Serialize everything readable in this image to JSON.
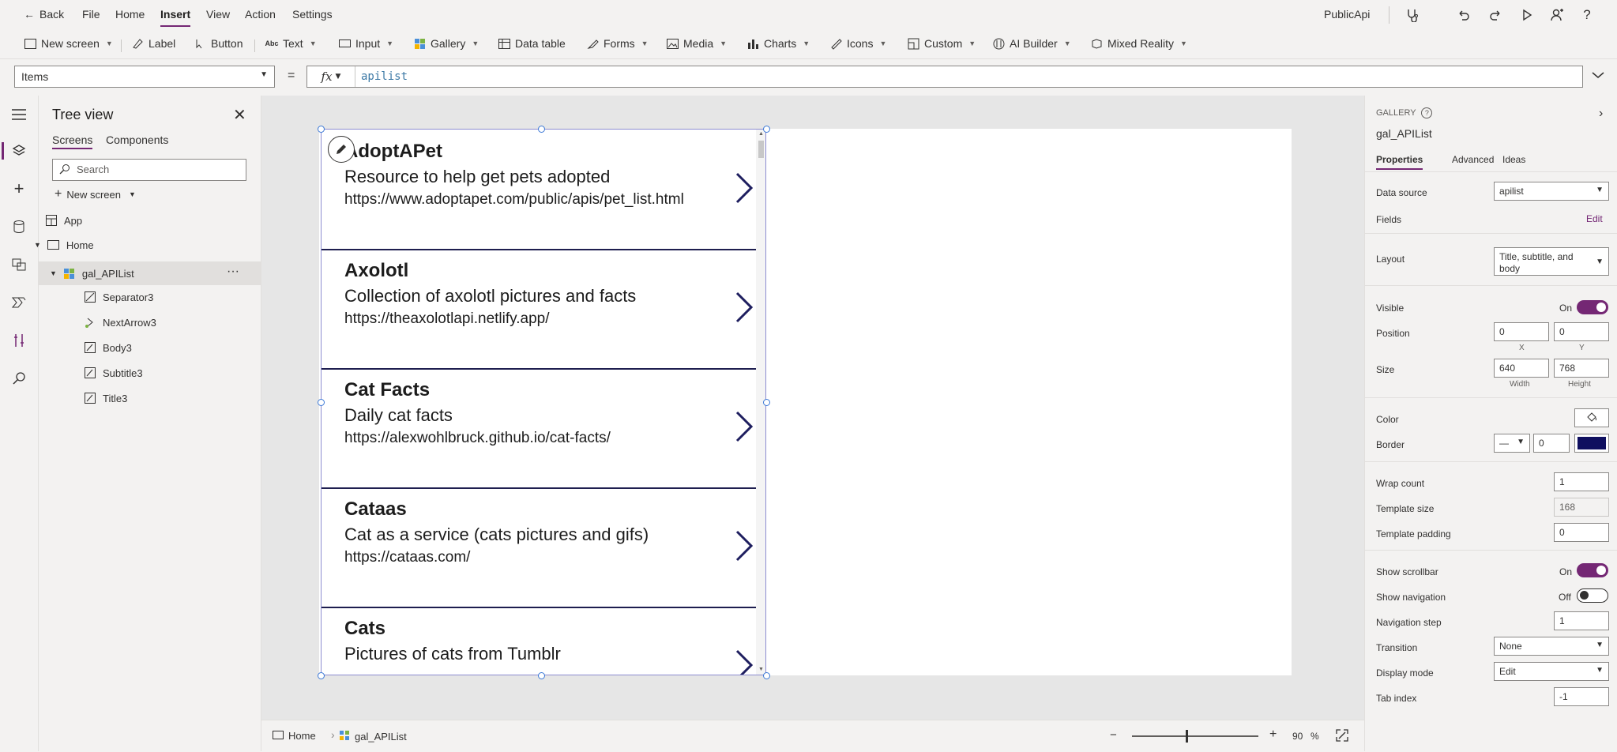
{
  "topbar": {
    "back": "Back",
    "menus": [
      "File",
      "Home",
      "Insert",
      "View",
      "Action",
      "Settings"
    ],
    "active_menu": "Insert",
    "app_name": "PublicApi"
  },
  "ribbon": {
    "items": [
      "New screen",
      "Label",
      "Button",
      "Text",
      "Input",
      "Gallery",
      "Data table",
      "Forms",
      "Media",
      "Charts",
      "Icons",
      "Custom",
      "AI Builder",
      "Mixed Reality"
    ]
  },
  "formula": {
    "property": "Items",
    "equals": "=",
    "fx": "fx",
    "value": "apilist"
  },
  "tree": {
    "title": "Tree view",
    "tabs": [
      "Screens",
      "Components"
    ],
    "search_placeholder": "Search",
    "new_screen": "New screen",
    "items": {
      "app": "App",
      "home": "Home",
      "gallery": "gal_APIList",
      "separator": "Separator3",
      "arrow": "NextArrow3",
      "body": "Body3",
      "subtitle": "Subtitle3",
      "title": "Title3"
    }
  },
  "gallery": {
    "rows": [
      {
        "title": "AdoptAPet",
        "subtitle": "Resource to help get pets adopted",
        "body": "https://www.adoptapet.com/public/apis/pet_list.html"
      },
      {
        "title": "Axolotl",
        "subtitle": "Collection of axolotl pictures and facts",
        "body": "https://theaxolotlapi.netlify.app/"
      },
      {
        "title": "Cat Facts",
        "subtitle": "Daily cat facts",
        "body": "https://alexwohlbruck.github.io/cat-facts/"
      },
      {
        "title": "Cataas",
        "subtitle": "Cat as a service (cats pictures and gifs)",
        "body": "https://cataas.com/"
      },
      {
        "title": "Cats",
        "subtitle": "Pictures of cats from Tumblr",
        "body": ""
      }
    ]
  },
  "status": {
    "screen": "Home",
    "control": "gal_APIList",
    "zoom": "90",
    "zoom_unit": "%",
    "minus": "−",
    "plus": "+"
  },
  "props": {
    "type": "GALLERY",
    "name": "gal_APIList",
    "tabs": [
      "Properties",
      "Advanced",
      "Ideas"
    ],
    "data_source_label": "Data source",
    "data_source": "apilist",
    "fields_label": "Fields",
    "fields_edit": "Edit",
    "layout_label": "Layout",
    "layout": "Title, subtitle, and body",
    "visible_label": "Visible",
    "visible_state": "On",
    "position_label": "Position",
    "x": "0",
    "y": "0",
    "x_sub": "X",
    "y_sub": "Y",
    "size_label": "Size",
    "width": "640",
    "height": "768",
    "width_sub": "Width",
    "height_sub": "Height",
    "color_label": "Color",
    "border_label": "Border",
    "border_width": "0",
    "border_color": "#0f0f5f",
    "wrap_label": "Wrap count",
    "wrap": "1",
    "template_size_label": "Template size",
    "template_size": "168",
    "template_padding_label": "Template padding",
    "template_padding": "0",
    "show_scrollbar_label": "Show scrollbar",
    "show_scrollbar_state": "On",
    "show_nav_label": "Show navigation",
    "show_nav_state": "Off",
    "nav_step_label": "Navigation step",
    "nav_step": "1",
    "transition_label": "Transition",
    "transition": "None",
    "display_mode_label": "Display mode",
    "display_mode": "Edit",
    "tab_index_label": "Tab index",
    "tab_index": "-1"
  },
  "colors": {
    "accent": "#742774",
    "arrow": "#1e1e5f",
    "separator": "#1e1e4f",
    "selection": "#3b78d6"
  }
}
